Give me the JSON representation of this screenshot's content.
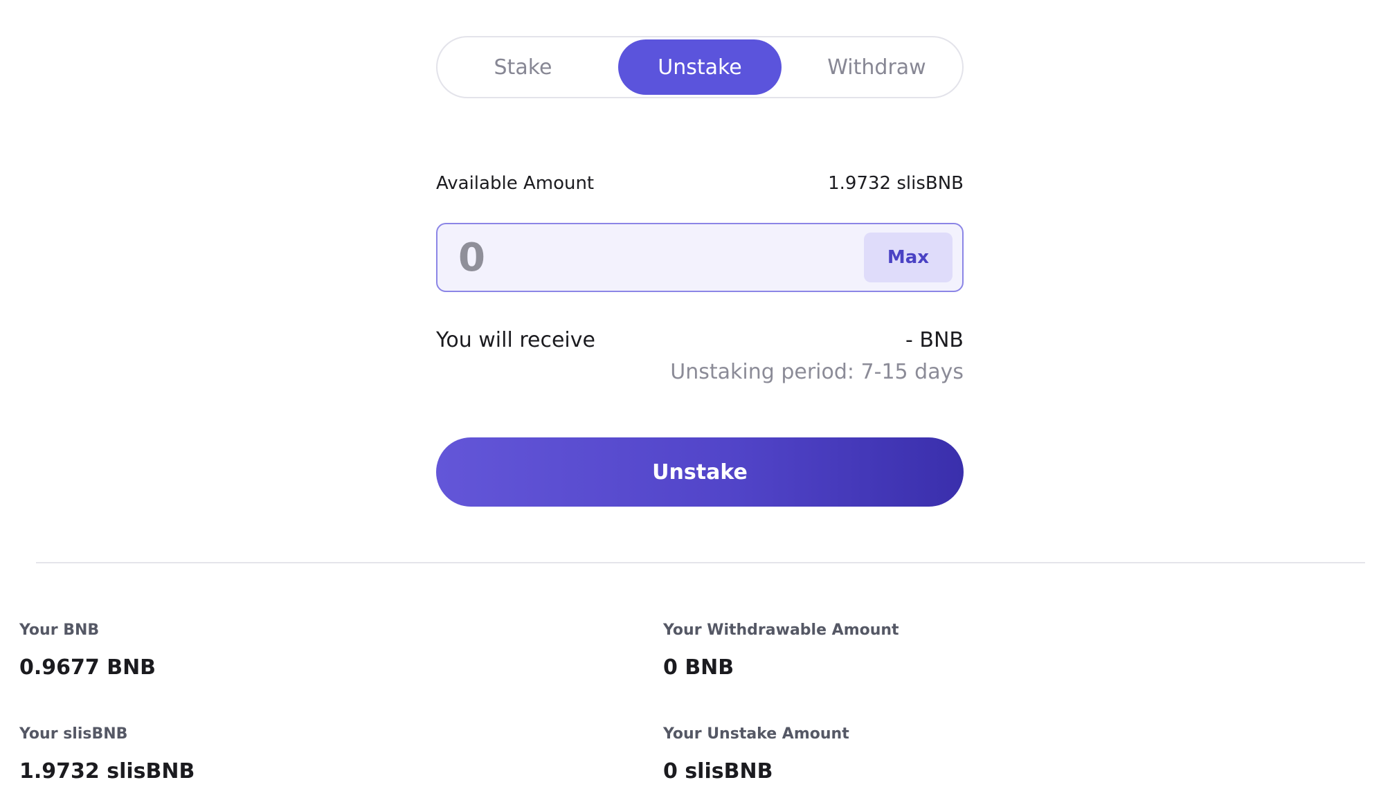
{
  "tabs": [
    {
      "label": "Stake",
      "active": false
    },
    {
      "label": "Unstake",
      "active": true
    },
    {
      "label": "Withdraw",
      "active": false
    }
  ],
  "form": {
    "available_label": "Available Amount",
    "available_value": "1.9732 slisBNB",
    "amount_placeholder": "0",
    "max_label": "Max",
    "receive_label": "You will receive",
    "receive_value": "- BNB",
    "unstaking_period": "Unstaking period: 7-15 days",
    "submit_label": "Unstake"
  },
  "stats": {
    "bnb_label": "Your BNB",
    "bnb_value": "0.9677 BNB",
    "withdrawable_label": "Your Withdrawable Amount",
    "withdrawable_value": "0 BNB",
    "slisbnb_label": "Your slisBNB",
    "slisbnb_value": "1.9732 slisBNB",
    "unstake_label": "Your Unstake Amount",
    "unstake_value": "0 slisBNB"
  },
  "colors": {
    "accent": "#5b54dc",
    "input_bg": "#f3f2fd",
    "max_bg": "#dfdcfa"
  }
}
